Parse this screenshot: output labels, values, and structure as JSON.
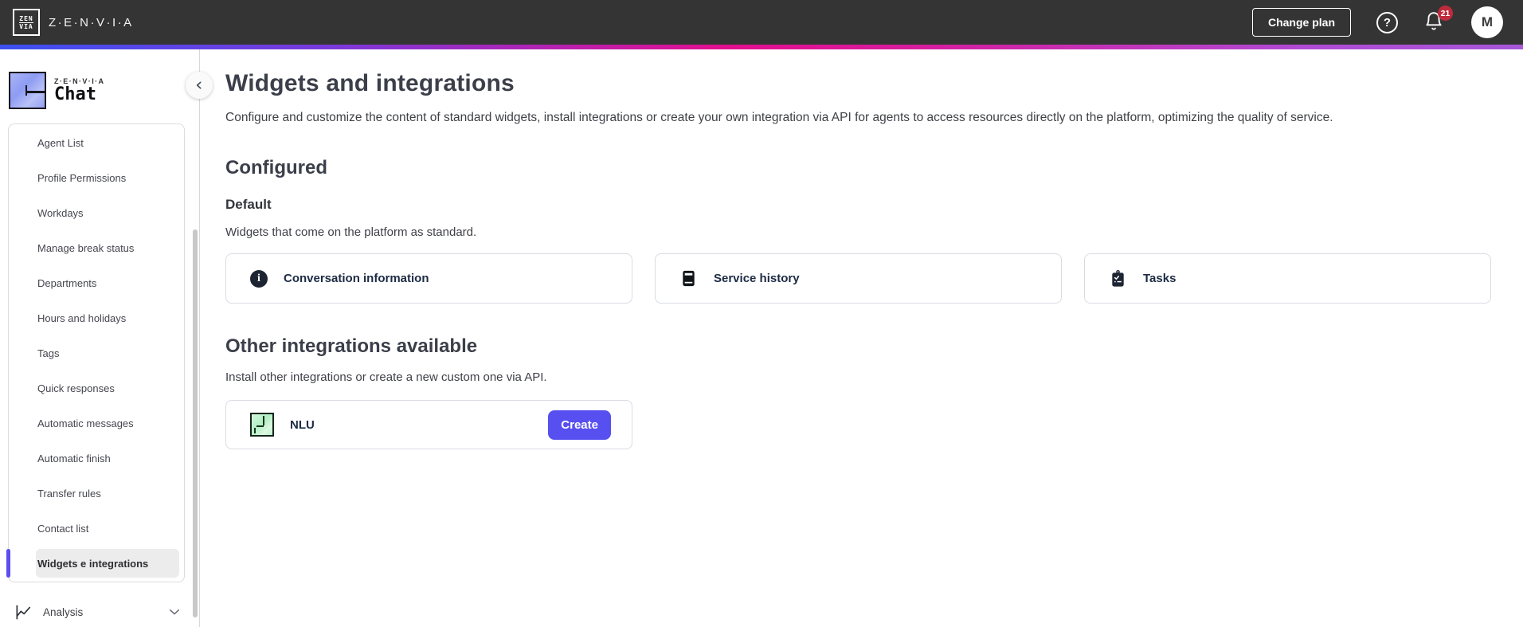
{
  "topbar": {
    "logo": {
      "top": "ZEN",
      "bottom": "VIA"
    },
    "brand": "Z·E·N·V·I·A",
    "change_plan_label": "Change plan",
    "help_glyph": "?",
    "notification_count": "21",
    "avatar_initial": "M"
  },
  "sidebar": {
    "brand": "Z·E·N·V·I·A",
    "product": "Chat",
    "items": [
      {
        "label": "Agent List",
        "active": false
      },
      {
        "label": "Profile Permissions",
        "active": false
      },
      {
        "label": "Workdays",
        "active": false
      },
      {
        "label": "Manage break status",
        "active": false
      },
      {
        "label": "Departments",
        "active": false
      },
      {
        "label": "Hours and holidays",
        "active": false
      },
      {
        "label": "Tags",
        "active": false
      },
      {
        "label": "Quick responses",
        "active": false
      },
      {
        "label": "Automatic messages",
        "active": false
      },
      {
        "label": "Automatic finish",
        "active": false
      },
      {
        "label": "Transfer rules",
        "active": false
      },
      {
        "label": "Contact list",
        "active": false
      },
      {
        "label": "Widgets e integrations",
        "active": true
      }
    ],
    "analysis": {
      "label": "Analysis",
      "icon": "line-chart-icon",
      "chevron": "chevron-down-icon"
    }
  },
  "main": {
    "title": "Widgets and integrations",
    "description": "Configure and customize the content of standard widgets, install integrations or create your own integration via API for agents to access resources directly on the platform, optimizing the quality of service.",
    "configured": {
      "heading": "Configured",
      "subheading": "Default",
      "description": "Widgets that come on the platform as standard.",
      "widgets": [
        {
          "label": "Conversation information",
          "icon": "info-circle-icon",
          "glyph": "i"
        },
        {
          "label": "Service history",
          "icon": "book-icon"
        },
        {
          "label": "Tasks",
          "icon": "clipboard-check-icon"
        }
      ]
    },
    "other": {
      "heading": "Other integrations available",
      "description": "Install other integrations or create a new custom one via API.",
      "integrations": [
        {
          "label": "NLU",
          "icon": "nlu-pixel-icon",
          "action_label": "Create"
        }
      ]
    }
  },
  "colors": {
    "topbar_bg": "#343434",
    "accent_purple": "#584ff0",
    "active_indicator": "#5a4ff1",
    "badge_red": "#bf2b3c",
    "gradient": [
      "#3b50f0",
      "#7c39da",
      "#e30e8e",
      "#a757d8"
    ]
  }
}
